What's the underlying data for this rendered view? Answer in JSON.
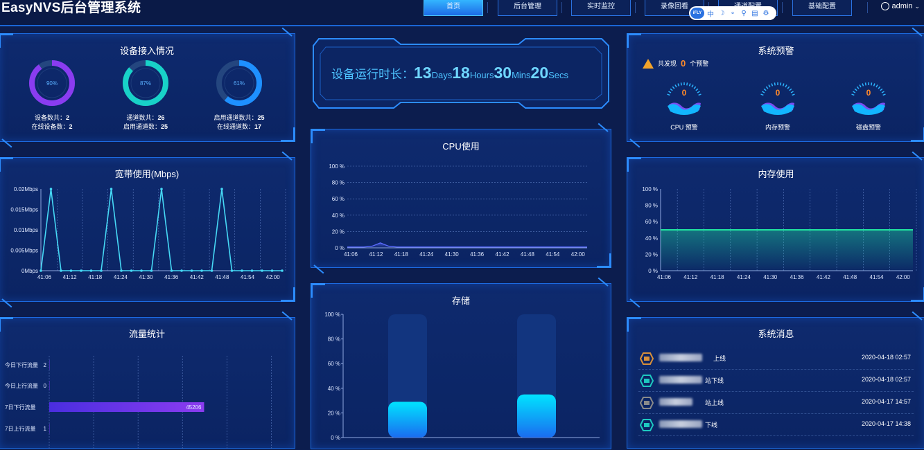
{
  "header": {
    "title": "EasyNVS后台管理系统",
    "nav": [
      "首页",
      "后台管理",
      "实时监控",
      "录像回看",
      "通道配置",
      "基础配置"
    ],
    "user": "admin",
    "ifly_logo": "iFLY",
    "ifly_icons": [
      "中",
      "☽",
      "∘",
      "⚲",
      "▤",
      "⚙"
    ]
  },
  "devices": {
    "title": "设备接入情况",
    "rings": [
      {
        "percent": "90%",
        "value": 90,
        "line1_label": "设备数共：",
        "line1_value": "2",
        "line2_label": "在线设备数：",
        "line2_value": "2",
        "color": "#8a3cf0"
      },
      {
        "percent": "87%",
        "value": 87,
        "line1_label": "通道数共：",
        "line1_value": "26",
        "line2_label": "启用通道数：",
        "line2_value": "25",
        "color": "#18d2c8"
      },
      {
        "percent": "61%",
        "value": 61,
        "line1_label": "启用通道数共：",
        "line1_value": "25",
        "line2_label": "在线通道数：",
        "line2_value": "17",
        "color": "#1e90ff"
      }
    ]
  },
  "uptime": {
    "label": "设备运行时长：",
    "days": "13",
    "days_unit": "Days",
    "hours": "18",
    "hours_unit": "Hours",
    "mins": "30",
    "mins_unit": "Mins",
    "secs": "20",
    "secs_unit": "Secs"
  },
  "alerts": {
    "title": "系统预警",
    "prefix": "共发现",
    "count": "0",
    "suffix": "个预警",
    "gauges": [
      {
        "label": "CPU 预警",
        "value": "0"
      },
      {
        "label": "内存预警",
        "value": "0"
      },
      {
        "label": "磁盘预警",
        "value": "0"
      }
    ]
  },
  "bandwidth": {
    "title": "宽带使用(Mbps)"
  },
  "cpu": {
    "title": "CPU使用"
  },
  "memory": {
    "title": "内存使用"
  },
  "traffic": {
    "title": "流量统计"
  },
  "storage": {
    "title": "存储"
  },
  "messages": {
    "title": "系统消息",
    "items": [
      {
        "suffix": "上线",
        "time": "2020-04-18 02:57",
        "icon": "camera-icon",
        "color": "#d9903a"
      },
      {
        "suffix": "站下线",
        "time": "2020-04-18 02:57",
        "icon": "server-icon",
        "color": "#1ec8c0"
      },
      {
        "suffix": "站上线",
        "time": "2020-04-17 14:57",
        "icon": "device-icon",
        "color": "#8a8a8a"
      },
      {
        "suffix": "下线",
        "time": "2020-04-17 14:38",
        "icon": "server-icon",
        "color": "#1ec8c0"
      }
    ]
  },
  "chart_data": [
    {
      "type": "line",
      "title": "宽带使用(Mbps)",
      "x": [
        "41:06",
        "41:12",
        "41:18",
        "41:24",
        "41:30",
        "41:36",
        "41:42",
        "41:48",
        "41:54",
        "42:00"
      ],
      "y_ticks": [
        "0Mbps",
        "0.005Mbps",
        "0.01Mbps",
        "0.015Mbps",
        "0.02Mbps"
      ],
      "ylim": [
        0,
        0.02
      ],
      "series": [
        {
          "values": [
            0,
            0.02,
            0,
            0,
            0,
            0,
            0,
            0.02,
            0,
            0,
            0,
            0,
            0.02,
            0,
            0,
            0,
            0,
            0,
            0.02,
            0,
            0,
            0,
            0,
            0,
            0
          ]
        }
      ],
      "color": "#46d8f5"
    },
    {
      "type": "area",
      "title": "CPU使用",
      "x": [
        "41:06",
        "41:12",
        "41:18",
        "41:24",
        "41:30",
        "41:36",
        "41:42",
        "41:48",
        "41:54",
        "42:00"
      ],
      "y_ticks": [
        "0 %",
        "20 %",
        "40 %",
        "60 %",
        "80 %",
        "100 %"
      ],
      "ylim": [
        0,
        100
      ],
      "series": [
        {
          "values": [
            1,
            1,
            1,
            2,
            6,
            2,
            1,
            1,
            1,
            1,
            1,
            1,
            1,
            1,
            1,
            1,
            1,
            1,
            1,
            1,
            1,
            1,
            1,
            1,
            1,
            1,
            1,
            1,
            1,
            1
          ]
        }
      ],
      "color": "#5a6bff"
    },
    {
      "type": "area",
      "title": "内存使用",
      "x": [
        "41:06",
        "41:12",
        "41:18",
        "41:24",
        "41:30",
        "41:36",
        "41:42",
        "41:48",
        "41:54",
        "42:00"
      ],
      "y_ticks": [
        "0 %",
        "20 %",
        "40 %",
        "60 %",
        "80 %",
        "100 %"
      ],
      "ylim": [
        0,
        100
      ],
      "series": [
        {
          "values": [
            50,
            50,
            50,
            50,
            50,
            50,
            50,
            50,
            50,
            50,
            50
          ]
        }
      ],
      "color": "#20e3a0"
    },
    {
      "type": "bar",
      "title": "流量统计",
      "orientation": "horizontal",
      "categories": [
        "今日下行流量",
        "今日上行流量",
        "7日下行流量",
        "7日上行流量"
      ],
      "category_values_shown": [
        "2",
        "0",
        "45206",
        "1"
      ],
      "values": [
        2,
        0,
        45206,
        1
      ],
      "xlim": [
        0,
        70000
      ]
    },
    {
      "type": "bar",
      "title": "存储",
      "y_ticks": [
        "0 %",
        "20 %",
        "40 %",
        "60 %",
        "80 %",
        "100 %"
      ],
      "ylim": [
        0,
        100
      ],
      "values": [
        29,
        35
      ]
    }
  ]
}
